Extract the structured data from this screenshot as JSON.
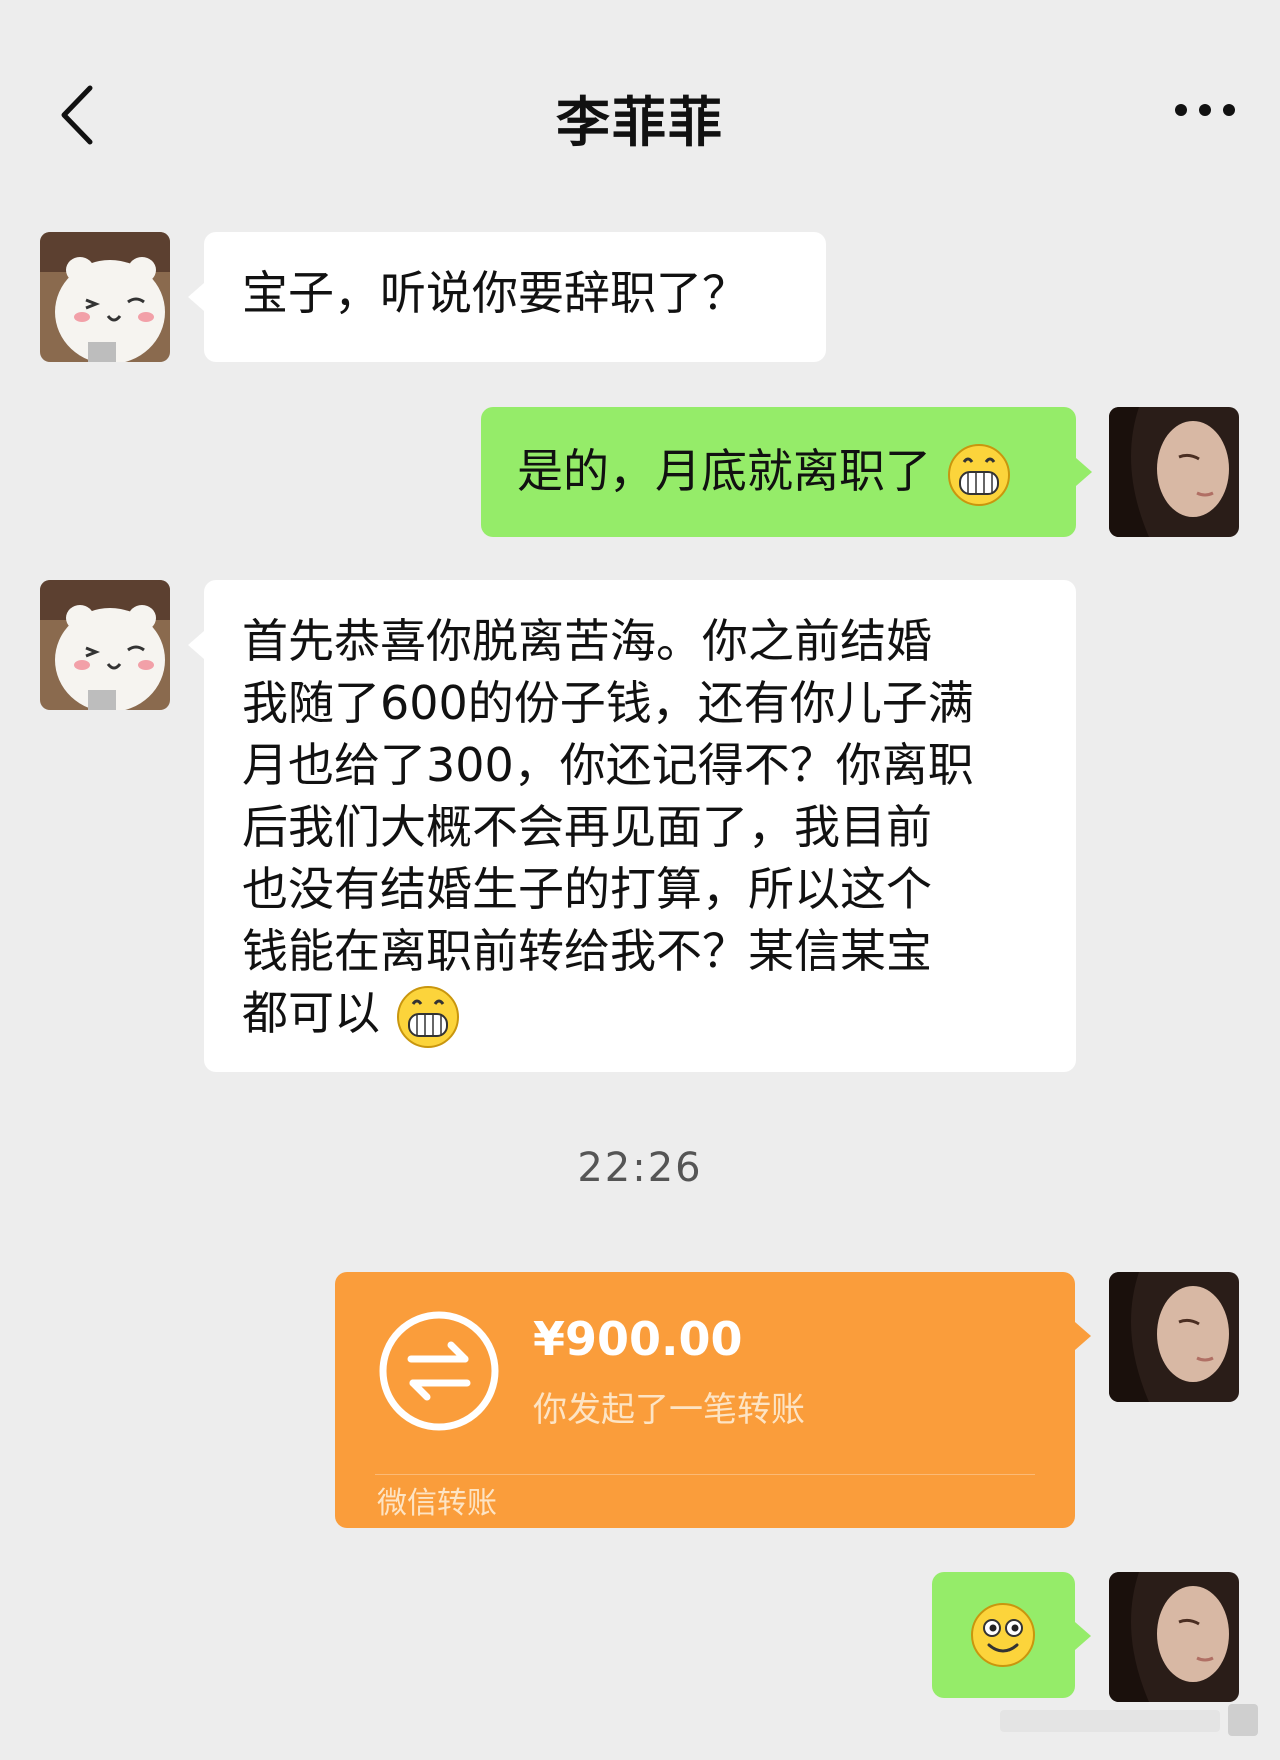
{
  "header": {
    "title": "李菲菲",
    "back_icon": "chevron-left-icon",
    "more_icon": "more-dots-icon"
  },
  "messages": [
    {
      "sender": "contact",
      "text": "宝子，听说你要辞职了？"
    },
    {
      "sender": "me",
      "text": "是的，月底就离职了",
      "emoji": "grin-emoji"
    },
    {
      "sender": "contact",
      "lines": [
        "首先恭喜你脱离苦海。你之前结婚",
        "我随了600的份子钱，还有你儿子满",
        "月也给了300，你还记得不？你离职",
        "后我们大概不会再见面了，我目前",
        "也没有结婚生子的打算，所以这个",
        "钱能在离职前转给我不？某信某宝",
        "都可以"
      ],
      "emoji": "grin-emoji"
    },
    {
      "sender": "me",
      "emoji_only": "smile-emoji"
    }
  ],
  "timestamp": "22:26",
  "transfer": {
    "amount": "¥900.00",
    "description": "你发起了一笔转账",
    "footer": "微信转账",
    "icon": "transfer-arrows-icon"
  },
  "colors": {
    "background": "#ededed",
    "bubble_me": "#95ec69",
    "bubble_contact": "#ffffff",
    "transfer": "#fa9d3b"
  }
}
